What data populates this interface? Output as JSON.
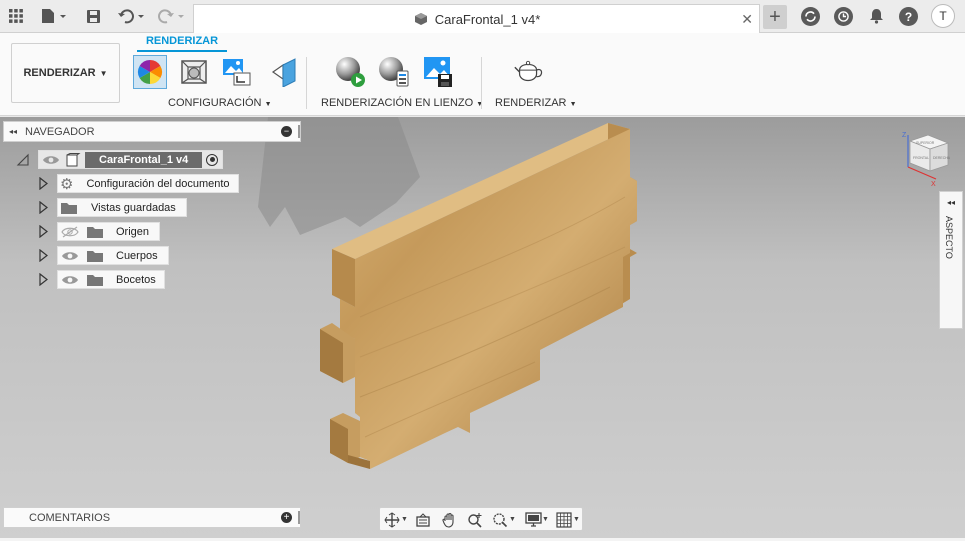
{
  "document": {
    "tab_title": "CaraFrontal_1 v4*"
  },
  "topbar": {
    "user_initial": "T"
  },
  "ribbon": {
    "workspace_label": "RENDERIZAR",
    "active_tab": "RENDERIZAR",
    "groups": {
      "configuration": "CONFIGURACIÓN",
      "canvas_render": "RENDERIZACIÓN EN LIENZO",
      "render": "RENDERIZAR"
    }
  },
  "navigator": {
    "title": "NAVEGADOR",
    "root": "CaraFrontal_1 v4",
    "items": [
      {
        "label": "Configuración del documento",
        "icon": "gear-icon"
      },
      {
        "label": "Vistas guardadas",
        "icon": "folder-icon"
      },
      {
        "label": "Origen",
        "icon": "folder-icon",
        "visibility": "hidden"
      },
      {
        "label": "Cuerpos",
        "icon": "folder-icon",
        "visibility": "visible"
      },
      {
        "label": "Bocetos",
        "icon": "folder-icon",
        "visibility": "visible"
      }
    ]
  },
  "comments": {
    "title": "COMENTARIOS"
  },
  "viewcube": {
    "axis_z": "Z",
    "axis_x": "X",
    "faces": [
      "SUPERIOR",
      "FRONTAL",
      "DERECHA"
    ]
  },
  "aspect_panel": {
    "label": "ASPECTO"
  },
  "colors": {
    "accent": "#0696d7",
    "wood": "#c9a062",
    "viewport_bg": "#c4c4c4"
  }
}
